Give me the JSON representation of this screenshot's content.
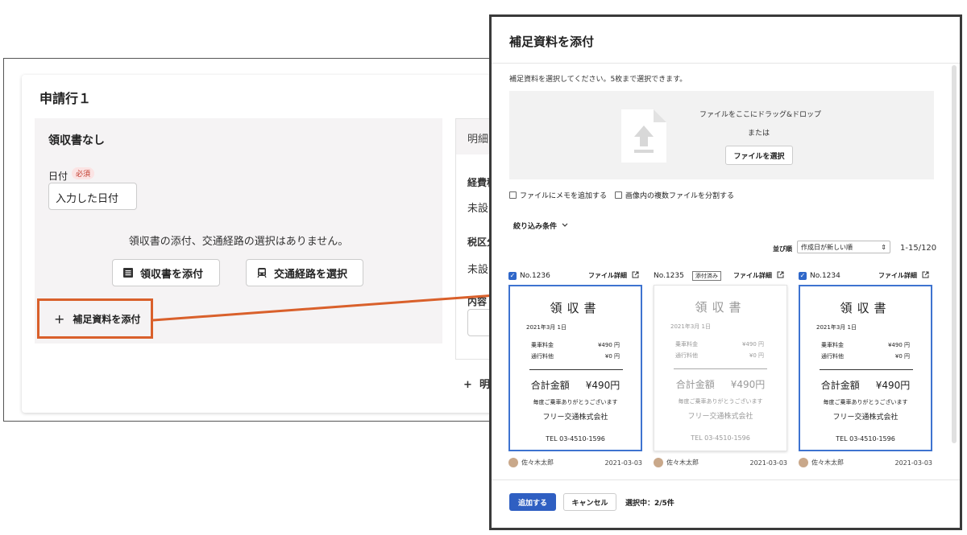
{
  "form": {
    "card_title": "申請行１",
    "left_panel": {
      "title": "領収書なし",
      "date_label": "日付",
      "required": "必須",
      "date_value": "入力した日付",
      "message": "領収書の添付、交通経路の選択はありません。",
      "attach_receipt": "領収書を添付",
      "select_route": "交通経路を選択",
      "add_supplementary": "補足資料を添付"
    },
    "right_panel": {
      "header": "明細",
      "expense_label": "経費科",
      "expense_value": "未設",
      "tax_label": "税区分",
      "tax_value": "未設",
      "content_label": "内容",
      "add_detail": "明"
    }
  },
  "modal": {
    "title": "補足資料を添付",
    "instruction": "補足資料を選択してください。5枚まで選択できます。",
    "drop_text": "ファイルをここにドラッグ&ドロップ",
    "drop_or": "または",
    "select_file": "ファイルを選択",
    "option_memo": "ファイルにメモを追加する",
    "option_split": "画像内の複数ファイルを分割する",
    "filter_label": "絞り込み条件",
    "sort_label": "並び順",
    "sort_value": "作成日が新しい順",
    "page_info": "1-15/120",
    "file_detail": "ファイル詳細",
    "items": [
      {
        "no": "No.1236",
        "checked": true,
        "tag": "",
        "uploader": "佐々木太郎",
        "date": "2021-03-03"
      },
      {
        "no": "No.1235",
        "checked": false,
        "tag": "添付済み",
        "uploader": "佐々木太郎",
        "date": "2021-03-03"
      },
      {
        "no": "No.1234",
        "checked": true,
        "tag": "",
        "uploader": "佐々木太郎",
        "date": "2021-03-03"
      }
    ],
    "receipt": {
      "title": "領収書",
      "date": "2021年3月 1日",
      "fare_label": "乗車料金",
      "fare_value": "¥490 円",
      "toll_label": "通行料他",
      "toll_value": "¥0 円",
      "total_label": "合計金額",
      "total_value": "¥490円",
      "thanks": "毎度ご乗車ありがとうございます",
      "company": "フリー交通株式会社",
      "tel": "TEL 03-4510-1596"
    },
    "add_button": "追加する",
    "cancel_button": "キャンセル",
    "selected_count": "選択中：2/5件"
  },
  "colors": {
    "accent_orange": "#d9602b",
    "primary_blue": "#2f5fc2",
    "selected_border": "#3e73d0"
  }
}
